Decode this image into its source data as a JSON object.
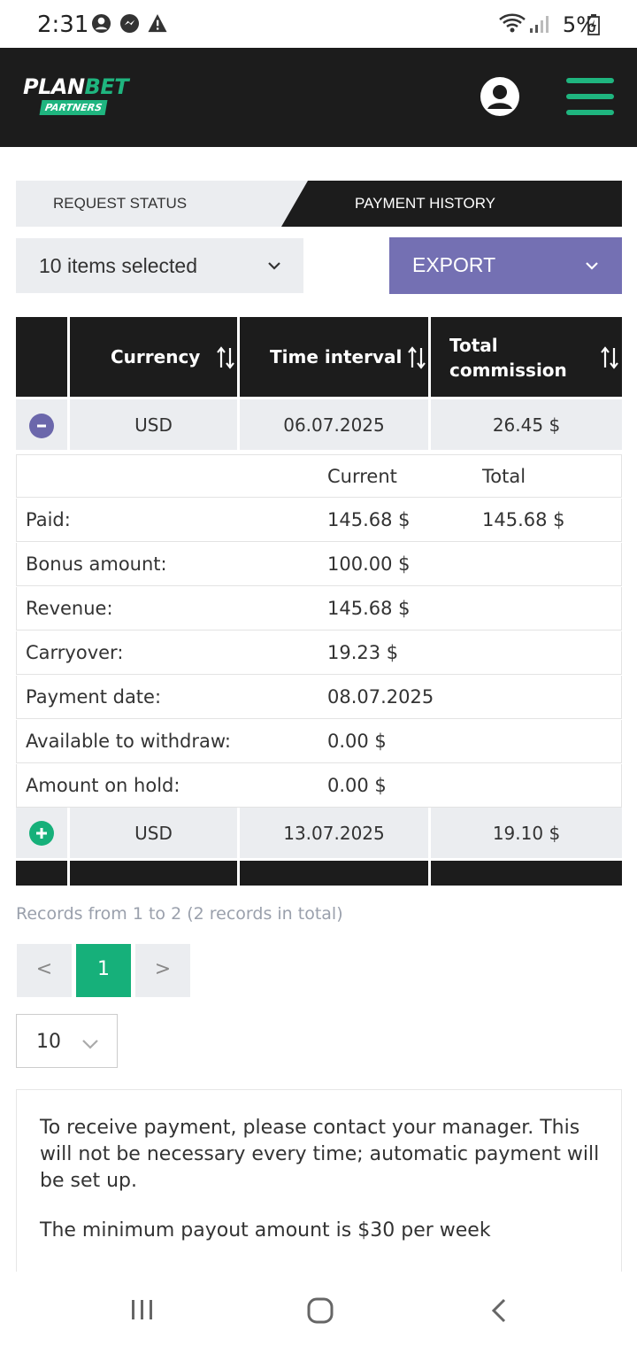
{
  "status_bar": {
    "time": "2:31",
    "battery": "5%"
  },
  "header": {
    "logo_plan": "PLAN",
    "logo_bet": "BET",
    "logo_partners": "PARTNERS",
    "accent": "#1fb57f",
    "background": "#1c1c1c"
  },
  "tabs": [
    {
      "label": "REQUEST STATUS",
      "active": false
    },
    {
      "label": "PAYMENT HISTORY",
      "active": true
    }
  ],
  "filters": {
    "items_selected": "10 items selected",
    "export_label": "EXPORT",
    "export_color": "#7470b3"
  },
  "table": {
    "columns": [
      "Currency",
      "Time interval",
      "Total commission"
    ],
    "rows": [
      {
        "toggle": "-",
        "currency": "USD",
        "interval": "06.07.2025",
        "commission": "26.45 $",
        "expanded": true
      },
      {
        "toggle": "+",
        "currency": "USD",
        "interval": "13.07.2025",
        "commission": "19.10 $",
        "expanded": false
      }
    ],
    "detail": {
      "header_current": "Current",
      "header_total": "Total",
      "items": [
        {
          "label": "Paid:",
          "current": "145.68 $",
          "total": "145.68 $"
        },
        {
          "label": "Bonus amount:",
          "current": "100.00 $",
          "total": ""
        },
        {
          "label": "Revenue:",
          "current": "145.68 $",
          "total": ""
        },
        {
          "label": "Carryover:",
          "current": "19.23 $",
          "total": ""
        },
        {
          "label": "Payment date:",
          "current": "08.07.2025",
          "total": ""
        },
        {
          "label": "Available to withdraw:",
          "current": "0.00 $",
          "total": ""
        },
        {
          "label": "Amount on hold:",
          "current": "0.00 $",
          "total": ""
        }
      ]
    }
  },
  "pagination": {
    "records_text": "Records from 1 to 2 (2 records in total)",
    "prev": "<",
    "current": "1",
    "next": ">",
    "per_page": "10"
  },
  "info": {
    "line1": "To receive payment, please contact your manager. This will not be necessary every time; automatic payment will be set up.",
    "line2": "The minimum payout amount is $30 per week"
  }
}
